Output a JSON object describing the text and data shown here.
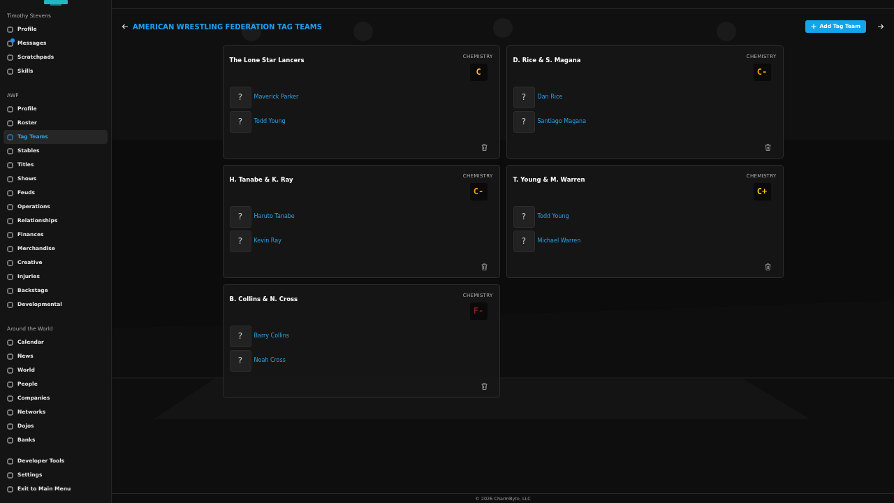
{
  "sidebar": {
    "sections": [
      {
        "title": "Timothy Stevens",
        "items": [
          {
            "label": "Profile",
            "selected": false,
            "notification": false
          },
          {
            "label": "Messages",
            "selected": false,
            "notification": true
          },
          {
            "label": "Scratchpads",
            "selected": false,
            "notification": false
          },
          {
            "label": "Skills",
            "selected": false,
            "notification": false
          }
        ]
      },
      {
        "title": "AWF",
        "items": [
          {
            "label": "Profile",
            "selected": false,
            "notification": false
          },
          {
            "label": "Roster",
            "selected": false,
            "notification": false
          },
          {
            "label": "Tag Teams",
            "selected": true,
            "notification": false
          },
          {
            "label": "Stables",
            "selected": false,
            "notification": false
          },
          {
            "label": "Titles",
            "selected": false,
            "notification": false
          },
          {
            "label": "Shows",
            "selected": false,
            "notification": false
          },
          {
            "label": "Feuds",
            "selected": false,
            "notification": false
          },
          {
            "label": "Operations",
            "selected": false,
            "notification": false
          },
          {
            "label": "Relationships",
            "selected": false,
            "notification": false
          },
          {
            "label": "Finances",
            "selected": false,
            "notification": false
          },
          {
            "label": "Merchandise",
            "selected": false,
            "notification": false
          },
          {
            "label": "Creative",
            "selected": false,
            "notification": false
          },
          {
            "label": "Injuries",
            "selected": false,
            "notification": false
          },
          {
            "label": "Backstage",
            "selected": false,
            "notification": false
          },
          {
            "label": "Developmental",
            "selected": false,
            "notification": false
          }
        ]
      },
      {
        "title": "Around the World",
        "items": [
          {
            "label": "Calendar",
            "selected": false,
            "notification": false
          },
          {
            "label": "News",
            "selected": false,
            "notification": false
          },
          {
            "label": "World",
            "selected": false,
            "notification": false
          },
          {
            "label": "People",
            "selected": false,
            "notification": false
          },
          {
            "label": "Companies",
            "selected": false,
            "notification": false
          },
          {
            "label": "Networks",
            "selected": false,
            "notification": false
          },
          {
            "label": "Dojos",
            "selected": false,
            "notification": false
          },
          {
            "label": "Banks",
            "selected": false,
            "notification": false
          }
        ]
      },
      {
        "items": [
          {
            "label": "Developer Tools",
            "selected": false,
            "notification": false
          },
          {
            "label": "Settings",
            "selected": false,
            "notification": false
          },
          {
            "label": "Exit to Main Menu",
            "selected": false,
            "notification": false
          }
        ]
      }
    ]
  },
  "header": {
    "title": "AMERICAN WRESTLING FEDERATION TAG TEAMS",
    "add_button": "Add Tag Team"
  },
  "teams": [
    {
      "name": "The Lone Star Lancers",
      "chemistry_label": "CHEMISTRY",
      "grade": "C",
      "color": "#f5c518",
      "members": [
        {
          "avatar": "?",
          "name": "Maverick Parker"
        },
        {
          "avatar": "?",
          "name": "Todd Young"
        }
      ]
    },
    {
      "name": "D. Rice & S. Magana",
      "chemistry_label": "CHEMISTRY",
      "grade": "C-",
      "color": "#f59e0b",
      "members": [
        {
          "avatar": "?",
          "name": "Dan Rice"
        },
        {
          "avatar": "?",
          "name": "Santiago Magana"
        }
      ]
    },
    {
      "name": "H. Tanabe & K. Ray",
      "chemistry_label": "CHEMISTRY",
      "grade": "C-",
      "color": "#f59e0b",
      "members": [
        {
          "avatar": "?",
          "name": "Haruto Tanabe"
        },
        {
          "avatar": "?",
          "name": "Kevin Ray"
        }
      ]
    },
    {
      "name": "T. Young & M. Warren",
      "chemistry_label": "CHEMISTRY",
      "grade": "C+",
      "color": "#f5c518",
      "members": [
        {
          "avatar": "?",
          "name": "Todd Young"
        },
        {
          "avatar": "?",
          "name": "Michael Warren"
        }
      ]
    },
    {
      "name": "B. Collins & N. Cross",
      "chemistry_label": "CHEMISTRY",
      "grade": "F-",
      "color": "#8b1a1a",
      "members": [
        {
          "avatar": "?",
          "name": "Barry Collins"
        },
        {
          "avatar": "?",
          "name": "Noah Cross"
        }
      ]
    }
  ],
  "footer": "© 2026 CharmByte, LLC"
}
